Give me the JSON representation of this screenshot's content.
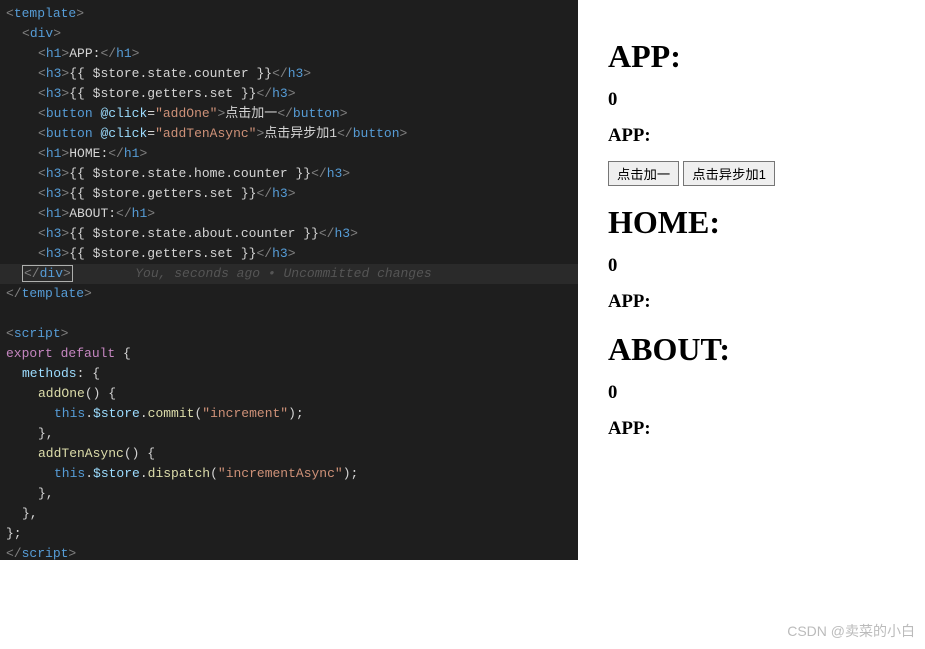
{
  "code": {
    "l1": "<template>",
    "l2_open": "<",
    "l2_tag": "div",
    "l2_close": ">",
    "l3_open": "<",
    "l3_tag": "h1",
    "l3_gt": ">",
    "l3_text": "APP:",
    "l3_copen": "</",
    "l3_cgt": ">",
    "l4_tag": "h3",
    "l4_text": "{{ $store.state.counter }}",
    "l5_text": "{{ $store.getters.set }}",
    "l6_tag": "button",
    "l6_attr": "@click",
    "l6_eq": "=",
    "l6_val": "\"addOne\"",
    "l6_text": "点击加一",
    "l7_val": "\"addTenAsync\"",
    "l7_text": "点击异步加1",
    "l8_text": "HOME:",
    "l9_text": "{{ $store.state.home.counter }}",
    "l10_text": "{{ $store.getters.set }}",
    "l11_text": "ABOUT:",
    "l12_text": "{{ $store.state.about.counter }}",
    "l13_text": "{{ $store.getters.set }}",
    "l14_open": "</",
    "l14_tag": "div",
    "l14_close": ">",
    "gitlens": "You, seconds ago • Uncommitted changes",
    "l15": "</template>",
    "l17_open": "<",
    "l17_tag": "script",
    "l17_close": ">",
    "l18_kw1": "export",
    "l18_kw2": "default",
    "l18_brace": " {",
    "l19_prop": "methods",
    "l19_rest": ": {",
    "l20_fn": "addOne",
    "l20_rest": "() {",
    "l21_this": "this",
    "l21_dot1": ".",
    "l21_store": "$store",
    "l21_dot2": ".",
    "l21_method": "commit",
    "l21_paren": "(",
    "l21_str": "\"increment\"",
    "l21_end": ");",
    "l22": "},",
    "l23_fn": "addTenAsync",
    "l23_rest": "() {",
    "l24_method": "dispatch",
    "l24_str": "\"incrementAsync\"",
    "l25": "},",
    "l26": "},",
    "l27": "};",
    "l28_open": "</",
    "l28_tag": "script",
    "l28_close": ">"
  },
  "preview": {
    "app_h1": "APP:",
    "app_counter": "0",
    "app_set": "APP:",
    "btn1": "点击加一",
    "btn2": "点击异步加1",
    "home_h1": "HOME:",
    "home_counter": "0",
    "home_set": "APP:",
    "about_h1": "ABOUT:",
    "about_counter": "0",
    "about_set": "APP:"
  },
  "watermark": "CSDN @卖菜的小白"
}
